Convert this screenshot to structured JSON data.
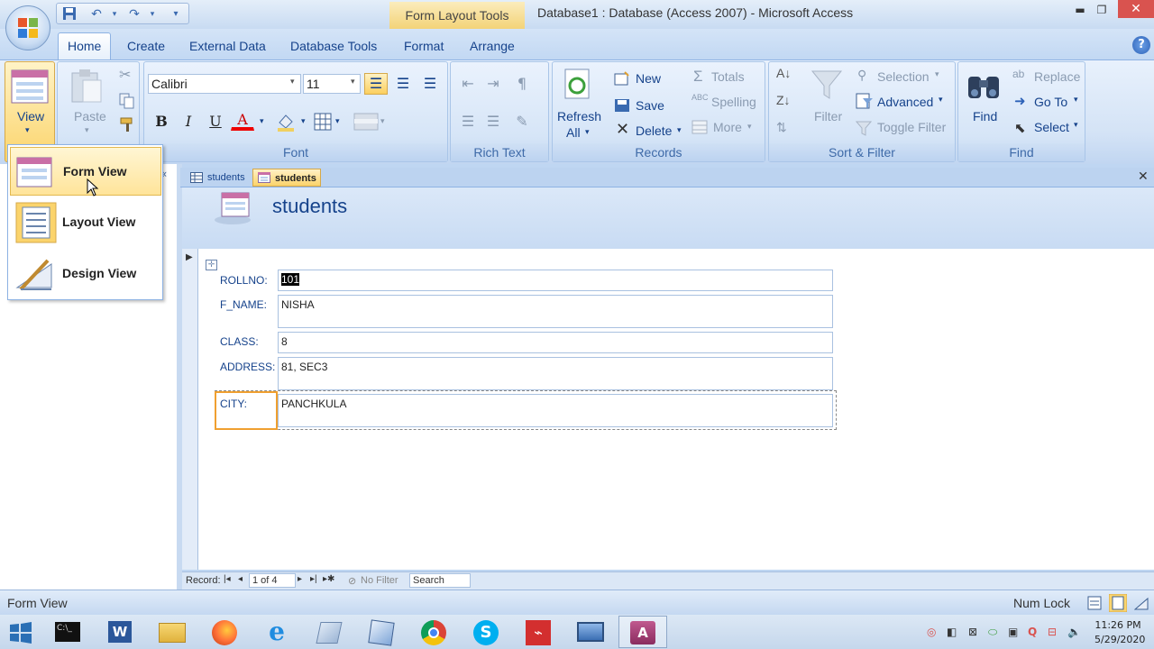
{
  "window": {
    "title": "Database1 : Database (Access 2007) - Microsoft Access",
    "context_tab": "Form Layout Tools",
    "minimize": "▬",
    "maximize": "❐",
    "close": "✕"
  },
  "ribbon_tabs": [
    "Home",
    "Create",
    "External Data",
    "Database Tools",
    "Format",
    "Arrange"
  ],
  "help": "?",
  "views": {
    "label": "View",
    "menu": [
      "Form View",
      "Layout View",
      "Design View"
    ]
  },
  "clipboard": {
    "paste": "Paste"
  },
  "font": {
    "family": "Calibri",
    "size": "11",
    "bold": "B",
    "italic": "I",
    "underline": "U",
    "font_color": "A",
    "group": "Font"
  },
  "rich_text": {
    "group": "Rich Text"
  },
  "records": {
    "refresh": "Refresh",
    "refresh_all": "All",
    "new": "New",
    "save": "Save",
    "delete": "Delete",
    "totals": "Totals",
    "spelling": "Spelling",
    "more": "More",
    "group": "Records"
  },
  "sort_filter": {
    "filter": "Filter",
    "selection": "Selection",
    "advanced": "Advanced",
    "toggle_filter": "Toggle Filter",
    "group": "Sort & Filter"
  },
  "find": {
    "find": "Find",
    "replace": "Replace",
    "goto": "Go To",
    "select": "Select",
    "group": "Find"
  },
  "doc_tabs": [
    "students",
    "students"
  ],
  "form": {
    "title": "students",
    "fields": [
      {
        "label": "ROLLNO:",
        "value": "101"
      },
      {
        "label": "F_NAME:",
        "value": "NISHA"
      },
      {
        "label": "CLASS:",
        "value": "8"
      },
      {
        "label": "ADDRESS:",
        "value": "81, SEC3"
      },
      {
        "label": "CITY:",
        "value": "PANCHKULA"
      }
    ]
  },
  "record_nav": {
    "label": "Record:",
    "position": "1 of 4",
    "filter": "No Filter",
    "search": "Search"
  },
  "status": {
    "left": "Form View",
    "num_lock": "Num Lock"
  },
  "taskbar": {
    "time": "11:26 PM",
    "date": "5/29/2020"
  },
  "colors": {
    "accent": "#15428b",
    "highlight": "#ffe49a",
    "selected_field_border": "#f0a030"
  }
}
